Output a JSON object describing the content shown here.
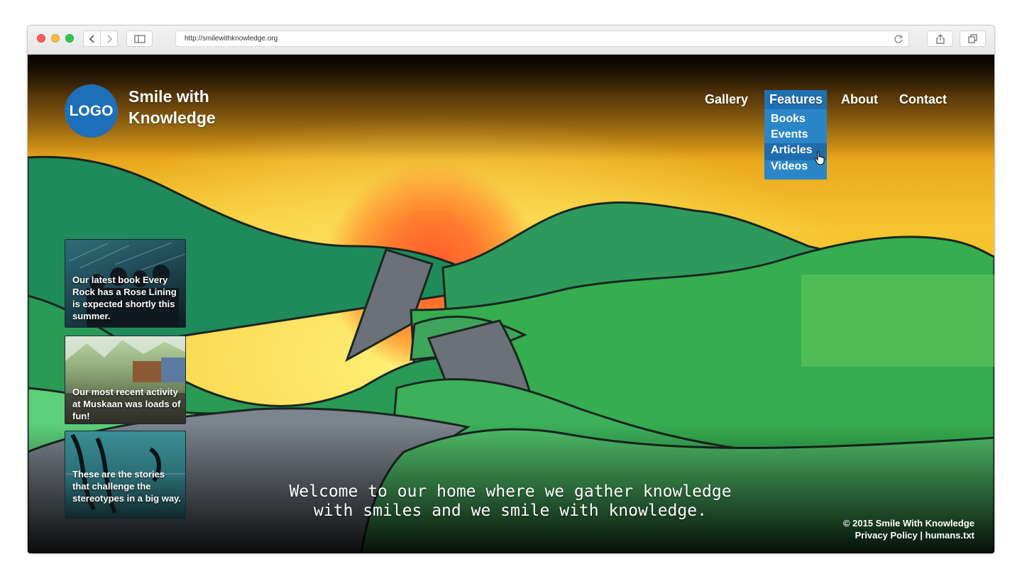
{
  "browser": {
    "url": "http://smilewithknowledge.org"
  },
  "header": {
    "logo": "LOGO",
    "brand_line1": "Smile with",
    "brand_line2": "Knowledge"
  },
  "nav": {
    "items": [
      "Gallery",
      "Features",
      "About",
      "Contact"
    ],
    "features_dropdown": [
      "Books",
      "Events",
      "Articles",
      "Videos"
    ],
    "hovered_item": "Articles"
  },
  "cards": [
    {
      "text": "Our latest book Every Rock has a Rose Lining is expected shortly this summer."
    },
    {
      "text": "Our most recent activity at Muskaan was loads of fun!"
    },
    {
      "text": "These are the stories that challenge the stereotypes in a big way."
    }
  ],
  "welcome": {
    "line1": "Welcome to our home where we gather knowledge",
    "line2": "with smiles and we smile with knowledge."
  },
  "footer": {
    "copyright": "© 2015 Smile With Knowledge",
    "privacy": "Privacy Policy",
    "separator": "|",
    "humans": "humans.txt"
  },
  "colors": {
    "accent_blue": "#1e6fb9",
    "dropdown_blue": "#2b86c8"
  }
}
